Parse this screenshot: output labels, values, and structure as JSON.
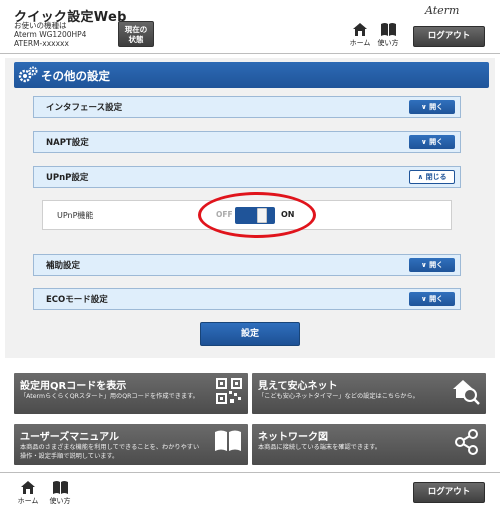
{
  "header": {
    "app_title": "クイック設定Web",
    "device_label": "お使いの機種は",
    "device_model": "Aterm WG1200HP4",
    "device_serial": "ATERM-xxxxxx",
    "status_line1": "現在の",
    "status_line2": "状態",
    "brand": "Aterm",
    "home_label": "ホーム",
    "help_label": "使い方",
    "logout_label": "ログアウト"
  },
  "page": {
    "title": "その他の設定"
  },
  "sections": [
    {
      "label": "インタフェース設定",
      "button": "開く"
    },
    {
      "label": "NAPT設定",
      "button": "開く"
    },
    {
      "label": "UPnP設定",
      "button": "閉じる"
    },
    {
      "label": "補助設定",
      "button": "開く"
    },
    {
      "label": "ECOモード設定",
      "button": "開く"
    }
  ],
  "upnp": {
    "label": "UPnP機能",
    "off_label": "OFF",
    "on_label": "ON",
    "enabled": true
  },
  "submit_label": "設定",
  "tiles": [
    {
      "title": "設定用QRコードを表示",
      "desc": "「AtermらくらくQRスタート」用のQRコードを作成できます。",
      "icon": "qr-code-icon"
    },
    {
      "title": "見えて安心ネット",
      "desc": "「こども安心ネットタイマー」などの設定はこちらから。",
      "icon": "home-search-icon"
    },
    {
      "title": "ユーザーズマニュアル",
      "desc": "本商品のさまざまな機能を利用してできることを、わかりやすい操作・設定手順で説明しています。",
      "icon": "book-icon"
    },
    {
      "title": "ネットワーク図",
      "desc": "本商品に接続している端末を確認できます。",
      "icon": "network-icon"
    }
  ],
  "footer": {
    "home_label": "ホーム",
    "help_label": "使い方",
    "logout_label": "ログアウト"
  },
  "colors": {
    "accent_blue": "#1f5499",
    "section_bg": "#dfeefb",
    "tile_gray": "#5a5a5a",
    "highlight_red": "#e0141c"
  }
}
